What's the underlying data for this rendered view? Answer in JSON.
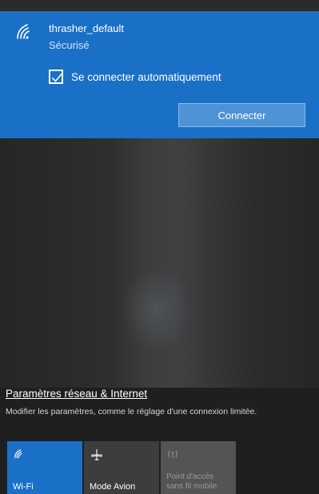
{
  "network": {
    "name": "thrasher_default",
    "status": "Sécurisé",
    "auto_connect_label": "Se connecter automatiquement",
    "auto_connect_checked": true,
    "connect_label": "Connecter",
    "icon": "wifi-signal-icon"
  },
  "settings": {
    "link_label": "Paramètres réseau & Internet",
    "description": "Modifier les paramètres, comme le réglage d'une connexion limitée."
  },
  "quick_actions": {
    "wifi": {
      "label": "Wi-Fi",
      "icon": "wifi-icon",
      "active": true
    },
    "airplane": {
      "label": "Mode Avion",
      "icon": "airplane-icon",
      "active": false
    },
    "hotspot": {
      "label_line1": "Point d'accès",
      "label_line2": "sans fil mobile",
      "icon": "hotspot-icon",
      "active": false,
      "disabled": true
    }
  },
  "colors": {
    "accent": "#1a70c7",
    "panel": "#1f1f1f",
    "connect_button": "#4e93d6"
  }
}
